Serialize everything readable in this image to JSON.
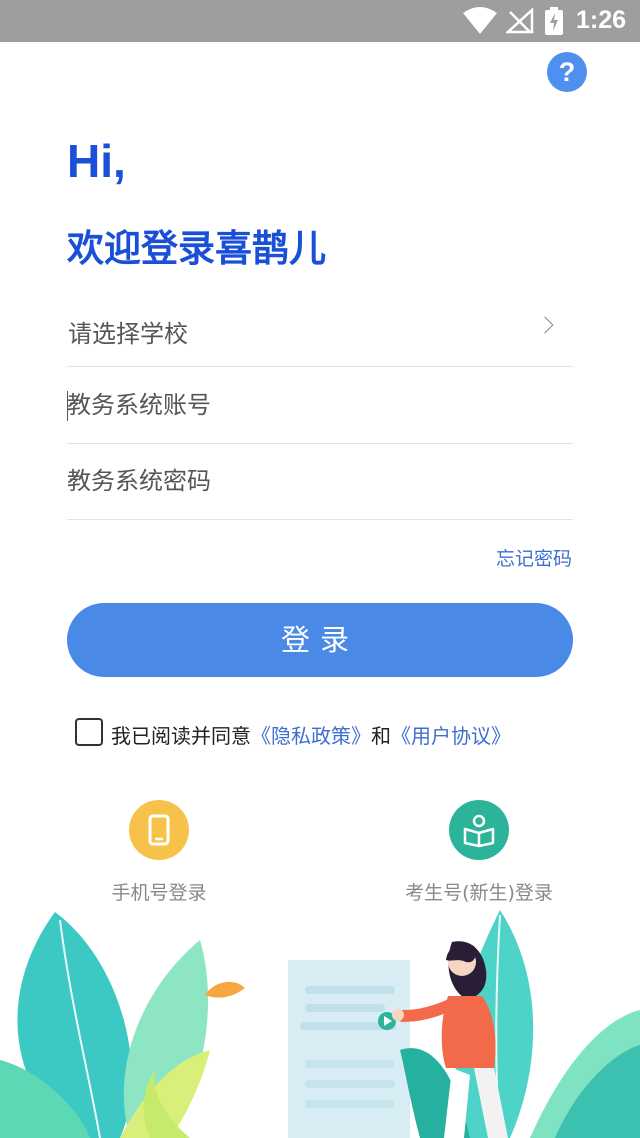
{
  "status_bar": {
    "time": "1:26",
    "icons": [
      "wifi-icon",
      "no-signal-icon",
      "battery-charging-icon"
    ]
  },
  "help": {
    "label": "?"
  },
  "greeting": {
    "hi": "Hi,",
    "welcome": "欢迎登录喜鹊儿"
  },
  "form": {
    "school_label": "请选择学校",
    "account_placeholder": "教务系统账号",
    "password_placeholder": "教务系统密码",
    "forgot_password": "忘记密码",
    "login_button": "登录"
  },
  "agreement": {
    "checked": false,
    "prefix": "我已阅读并同意",
    "privacy_link": "《隐私政策》",
    "and": "和",
    "user_link": "《用户协议》"
  },
  "alt_logins": {
    "phone": {
      "label": "手机号登录",
      "icon": "phone-icon"
    },
    "exam": {
      "label": "考生号(新生)登录",
      "icon": "book-icon"
    }
  },
  "colors": {
    "accent": "#1a4fd8",
    "button": "#4a89e6",
    "link": "#3e6fcf",
    "phone_circle": "#f7c24a",
    "exam_circle": "#2bb49a"
  }
}
